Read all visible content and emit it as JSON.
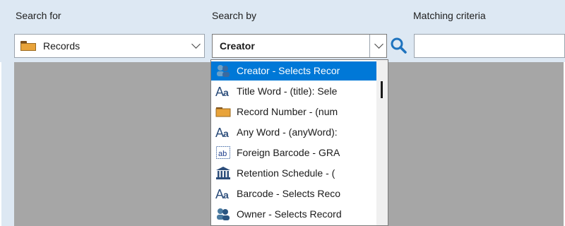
{
  "headers": {
    "search_for": "Search for",
    "search_by": "Search by",
    "matching_criteria": "Matching criteria"
  },
  "search_for": {
    "selected": "Records",
    "icon": "folder-icon"
  },
  "search_by": {
    "selected": "Creator"
  },
  "matching_criteria": {
    "value": ""
  },
  "dropdown": {
    "items": [
      {
        "label": "Creator - Selects Recor",
        "icon": "user-group-icon",
        "selected": true
      },
      {
        "label": "Title Word - (title): Sele",
        "icon": "text-aa-icon",
        "selected": false
      },
      {
        "label": "Record Number - (num",
        "icon": "folder-icon",
        "selected": false
      },
      {
        "label": "Any Word - (anyWord):",
        "icon": "text-aa-icon",
        "selected": false
      },
      {
        "label": "Foreign Barcode - GRA",
        "icon": "barcode-ab-icon",
        "selected": false
      },
      {
        "label": "Retention Schedule - (",
        "icon": "building-columns-icon",
        "selected": false
      },
      {
        "label": "Barcode - Selects Reco",
        "icon": "text-aa-icon",
        "selected": false
      },
      {
        "label": "Owner - Selects Record",
        "icon": "user-group-icon",
        "selected": false
      }
    ]
  },
  "colors": {
    "header_bg": "#dde8f3",
    "selection": "#0078d7",
    "content_bg": "#a6a6a6",
    "search_icon": "#1e73be"
  }
}
